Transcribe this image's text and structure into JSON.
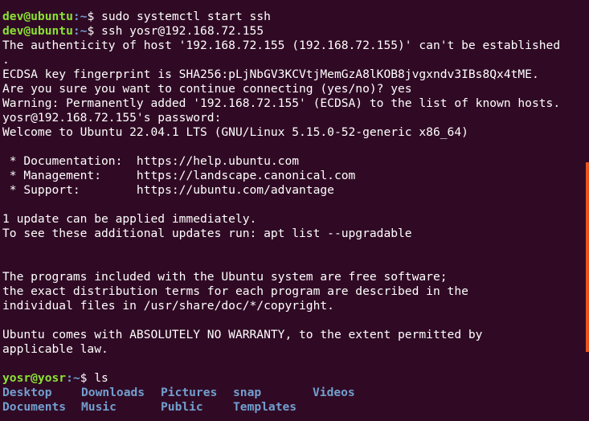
{
  "terminal": {
    "background": "#300a24",
    "prompt_user_color": "#8ae234",
    "prompt_path_color": "#729fcf",
    "scrollbar_color": "#e95420",
    "prompt1_user": "dev@ubuntu",
    "prompt1_path": ":~",
    "prompt1_symbol": "$ ",
    "cmd1": "sudo systemctl start ssh",
    "prompt2_user": "dev@ubuntu",
    "prompt2_path": ":~",
    "prompt2_symbol": "$ ",
    "cmd2": "ssh yosr@192.168.72.155",
    "out1": "The authenticity of host '192.168.72.155 (192.168.72.155)' can't be established",
    "out2": ".",
    "out3": "ECDSA key fingerprint is SHA256:pLjNbGV3KCVtjMemGzA8lKOB8jvgxndv3IBs8Qx4tME.",
    "out4": "Are you sure you want to continue connecting (yes/no)? yes",
    "out5": "Warning: Permanently added '192.168.72.155' (ECDSA) to the list of known hosts.",
    "out6": "yosr@192.168.72.155's password:",
    "out7": "Welcome to Ubuntu 22.04.1 LTS (GNU/Linux 5.15.0-52-generic x86_64)",
    "doc_line": " * Documentation:  https://help.ubuntu.com",
    "mgmt_line": " * Management:     https://landscape.canonical.com",
    "support_line": " * Support:        https://ubuntu.com/advantage",
    "update1": "1 update can be applied immediately.",
    "update2": "To see these additional updates run: apt list --upgradable",
    "prog1": "The programs included with the Ubuntu system are free software;",
    "prog2": "the exact distribution terms for each program are described in the",
    "prog3": "individual files in /usr/share/doc/*/copyright.",
    "warranty1": "Ubuntu comes with ABSOLUTELY NO WARRANTY, to the extent permitted by",
    "warranty2": "applicable law.",
    "prompt3_user": "yosr@yosr",
    "prompt3_path": ":~",
    "prompt3_symbol": "$ ",
    "cmd3": "ls",
    "ls_row1": [
      "Desktop",
      "Downloads",
      "Pictures",
      "snap",
      "Videos"
    ],
    "ls_row2": [
      "Documents",
      "Music",
      "Public",
      "Templates"
    ]
  }
}
